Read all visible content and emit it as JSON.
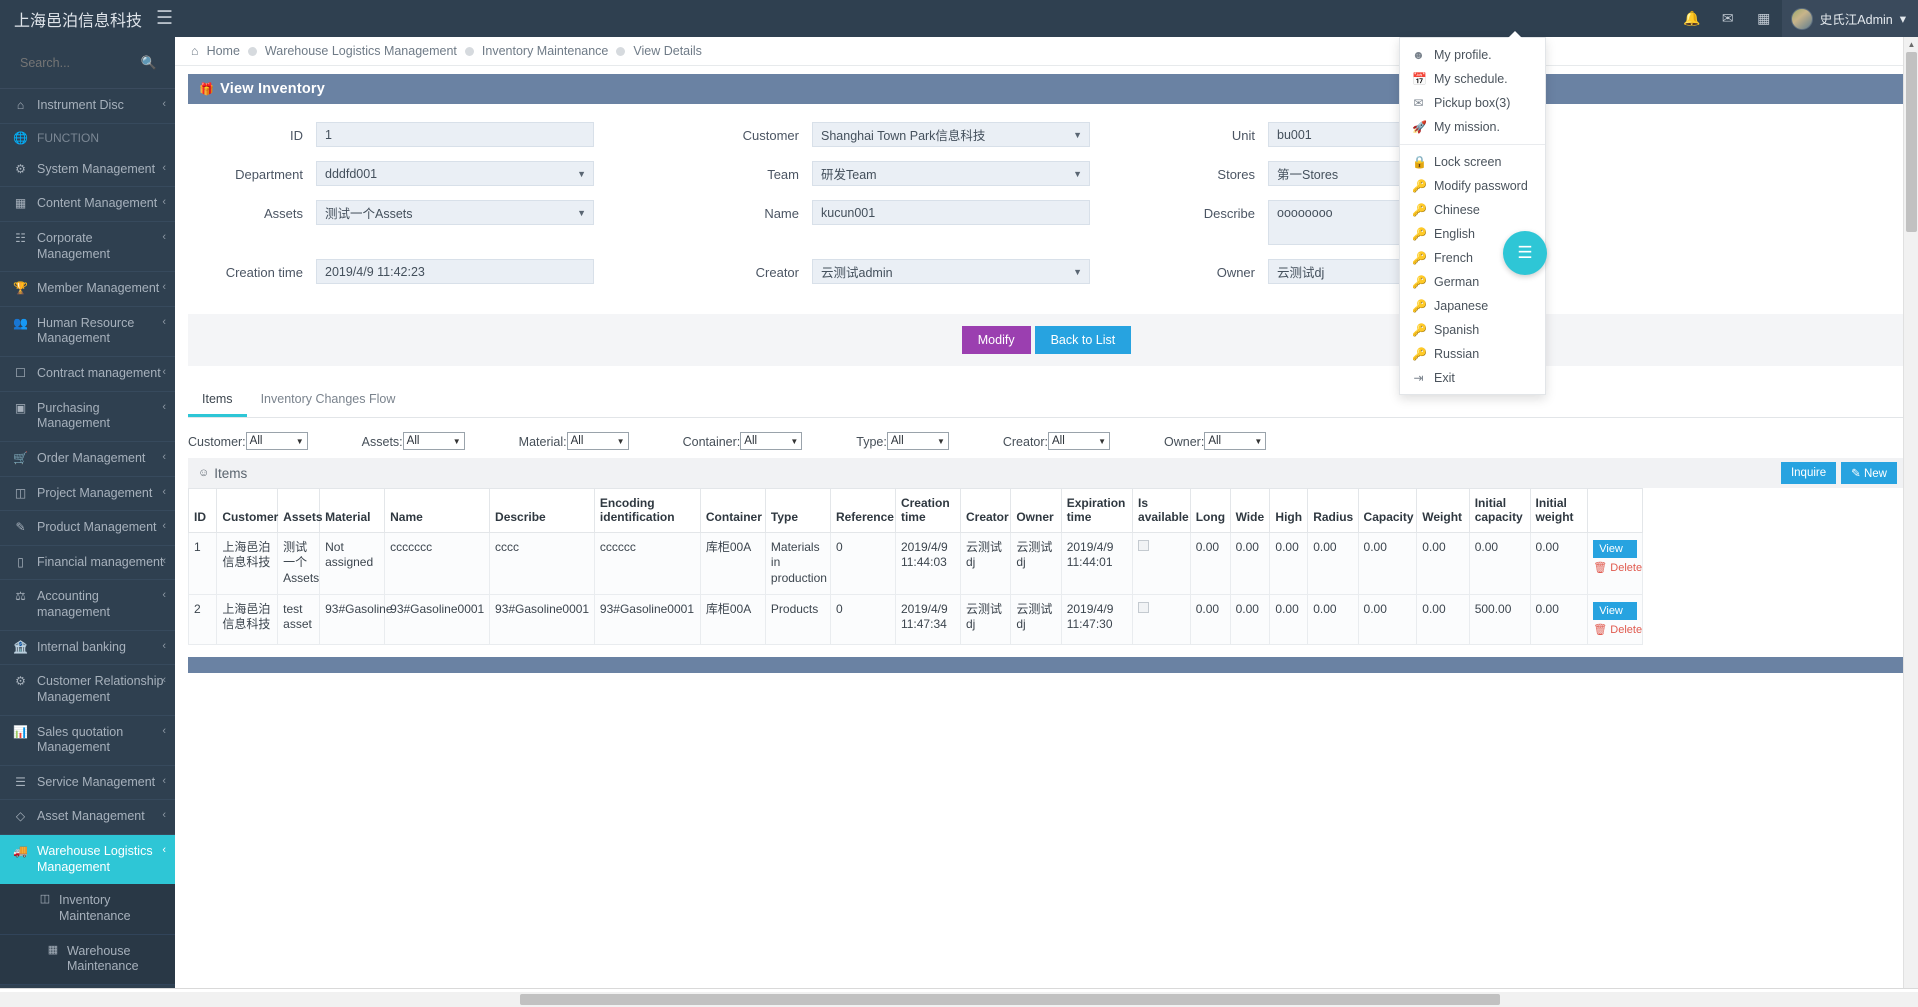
{
  "topbar": {
    "brand": "上海邑泊信息科技",
    "hamburger_icon": "hamburger-icon",
    "icons": [
      "bell-icon",
      "envelope-icon",
      "grid-icon"
    ],
    "user_name": "史氏江Admin",
    "user_caret": "▾"
  },
  "sidebar": {
    "search_placeholder": "Search...",
    "items": [
      {
        "label": "Instrument Disc",
        "icon": "home-icon",
        "caret": "‹",
        "type": "item"
      },
      {
        "label": "FUNCTION",
        "icon": "globe-icon",
        "caret": "",
        "type": "section"
      },
      {
        "label": "System Management",
        "icon": "gears-icon",
        "caret": "‹",
        "type": "item"
      },
      {
        "label": "Content Management",
        "icon": "article-icon",
        "caret": "‹",
        "type": "item"
      },
      {
        "label": "Corporate Management",
        "icon": "sitemap-icon",
        "caret": "‹",
        "type": "item"
      },
      {
        "label": "Member Management",
        "icon": "trophy-icon",
        "caret": "‹",
        "type": "item"
      },
      {
        "label": "Human Resource Management",
        "icon": "users-icon",
        "caret": "‹",
        "type": "item"
      },
      {
        "label": "Contract management",
        "icon": "document-icon",
        "caret": "‹",
        "type": "item"
      },
      {
        "label": "Purchasing Management",
        "icon": "box-icon",
        "caret": "‹",
        "type": "item"
      },
      {
        "label": "Order Management",
        "icon": "cart-icon",
        "caret": "‹",
        "type": "item"
      },
      {
        "label": "Project Management",
        "icon": "cubes-icon",
        "caret": "‹",
        "type": "item"
      },
      {
        "label": "Product Management",
        "icon": "edit-icon",
        "caret": "‹",
        "type": "item"
      },
      {
        "label": "Financial management",
        "icon": "money-icon",
        "caret": "‹",
        "type": "item"
      },
      {
        "label": "Accounting management",
        "icon": "balance-icon",
        "caret": "‹",
        "type": "item"
      },
      {
        "label": "Internal banking",
        "icon": "bank-icon",
        "caret": "‹",
        "type": "item"
      },
      {
        "label": "Customer Relationship Management",
        "icon": "gears-icon",
        "caret": "‹",
        "type": "item"
      },
      {
        "label": "Sales quotation Management",
        "icon": "chart-icon",
        "caret": "‹",
        "type": "item"
      },
      {
        "label": "Service Management",
        "icon": "list-icon",
        "caret": "‹",
        "type": "item"
      },
      {
        "label": "Asset Management",
        "icon": "diamond-icon",
        "caret": "‹",
        "type": "item"
      },
      {
        "label": "Warehouse Logistics Management",
        "icon": "truck-icon",
        "caret": "‹",
        "type": "active"
      }
    ],
    "subitems": [
      {
        "label": "Inventory Maintenance",
        "icon": "cubes-icon"
      },
      {
        "label": "Warehouse Maintenance",
        "icon": "warehouse-icon"
      }
    ]
  },
  "breadcrumb": {
    "home_icon": "home-icon",
    "items": [
      "Home",
      "Warehouse Logistics Management",
      "Inventory Maintenance",
      "View Details"
    ]
  },
  "panel": {
    "title": "View Inventory",
    "title_icon": "gift-icon"
  },
  "form": {
    "fields": [
      {
        "label": "ID",
        "value": "1",
        "type": "text"
      },
      {
        "label": "Customer",
        "value": "Shanghai Town Park信息科技",
        "type": "select"
      },
      {
        "label": "Unit",
        "value": "bu001",
        "type": "text"
      },
      {
        "label": "Department",
        "value": "dddfd001",
        "type": "select"
      },
      {
        "label": "Team",
        "value": "研发Team",
        "type": "select"
      },
      {
        "label": "Stores",
        "value": "第一Stores",
        "type": "text"
      },
      {
        "label": "Assets",
        "value": "测试一个Assets",
        "type": "select"
      },
      {
        "label": "Name",
        "value": "kucun001",
        "type": "text"
      },
      {
        "label": "Describe",
        "value": "oooooooo",
        "type": "textarea"
      },
      {
        "label": "Creation time",
        "value": "2019/4/9 11:42:23",
        "type": "text"
      },
      {
        "label": "Creator",
        "value": "云测试admin",
        "type": "select"
      },
      {
        "label": "Owner",
        "value": "云测试dj",
        "type": "text"
      }
    ],
    "buttons": {
      "modify": "Modify",
      "back": "Back to List"
    }
  },
  "tabs": [
    {
      "label": "Items",
      "active": true
    },
    {
      "label": "Inventory Changes Flow",
      "active": false
    }
  ],
  "filters": [
    {
      "label": "Customer:",
      "value": "All"
    },
    {
      "label": "Assets:",
      "value": "All"
    },
    {
      "label": "Material:",
      "value": "All"
    },
    {
      "label": "Container:",
      "value": "All"
    },
    {
      "label": "Type:",
      "value": "All"
    },
    {
      "label": "Creator:",
      "value": "All"
    },
    {
      "label": "Owner:",
      "value": "All"
    }
  ],
  "items_panel": {
    "title": "Items",
    "title_icon": "person-icon",
    "inquire_label": "Inquire",
    "new_label": "New",
    "new_icon": "pencil-icon"
  },
  "table": {
    "columns": [
      "ID",
      "Customer",
      "Assets",
      "Material",
      "Name",
      "Describe",
      "Encoding identification",
      "Container",
      "Type",
      "Reference",
      "Creation time",
      "Creator",
      "Owner",
      "Expiration time",
      "Is available",
      "Long",
      "Wide",
      "High",
      "Radius",
      "Capacity",
      "Weight",
      "Initial capacity",
      "Initial weight",
      ""
    ],
    "rows": [
      {
        "id": "1",
        "customer": "上海邑泊信息科技",
        "assets": "测试一个Assets",
        "material": "Not assigned",
        "name": "ccccccc",
        "describe": "cccc",
        "encoding": "cccccc",
        "container": "库柜00A",
        "type": "Materials in production",
        "reference": "0",
        "creation_time": "2019/4/9 11:44:03",
        "creator": "云测试dj",
        "owner": "云测试dj",
        "expiration_time": "2019/4/9 11:44:01",
        "is_available": "",
        "long": "0.00",
        "wide": "0.00",
        "high": "0.00",
        "radius": "0.00",
        "capacity": "0.00",
        "weight": "0.00",
        "initial_capacity": "0.00",
        "initial_weight": "0.00",
        "view_label": "View",
        "delete_label": "Delete"
      },
      {
        "id": "2",
        "customer": "上海邑泊信息科技",
        "assets": "test asset",
        "material": "93#Gasoline",
        "name": "93#Gasoline0001",
        "describe": "93#Gasoline0001",
        "encoding": "93#Gasoline0001",
        "container": "库柜00A",
        "type": "Products",
        "reference": "0",
        "creation_time": "2019/4/9 11:47:34",
        "creator": "云测试dj",
        "owner": "云测试dj",
        "expiration_time": "2019/4/9 11:47:30",
        "is_available": "",
        "long": "0.00",
        "wide": "0.00",
        "high": "0.00",
        "radius": "0.00",
        "capacity": "0.00",
        "weight": "0.00",
        "initial_capacity": "500.00",
        "initial_weight": "0.00",
        "view_label": "View",
        "delete_label": "Delete"
      }
    ]
  },
  "usermenu": {
    "groups": [
      [
        {
          "label": "My profile.",
          "icon": "user-icon"
        },
        {
          "label": "My schedule.",
          "icon": "calendar-icon"
        },
        {
          "label": "Pickup box(3)",
          "icon": "envelope-icon"
        },
        {
          "label": "My mission.",
          "icon": "rocket-icon"
        }
      ],
      [
        {
          "label": "Lock screen",
          "icon": "lock-icon"
        },
        {
          "label": "Modify password",
          "icon": "key-icon"
        },
        {
          "label": "Chinese",
          "icon": "key-icon"
        },
        {
          "label": "English",
          "icon": "key-icon"
        },
        {
          "label": "French",
          "icon": "key-icon"
        },
        {
          "label": "German",
          "icon": "key-icon"
        },
        {
          "label": "Japanese",
          "icon": "key-icon"
        },
        {
          "label": "Spanish",
          "icon": "key-icon"
        },
        {
          "label": "Russian",
          "icon": "key-icon"
        },
        {
          "label": "Exit",
          "icon": "exit-icon"
        }
      ]
    ]
  },
  "fab": {
    "icon": "menu-icon"
  },
  "statusbar": {
    "text": "javascript:;"
  },
  "colors": {
    "sidebar_bg": "#2f4050",
    "accent_cyan": "#2ec6d6",
    "panel_header": "#6a82a3",
    "primary_blue": "#27a3e0",
    "modify_purple": "#9b3fb0",
    "danger_red": "#e05a4f"
  }
}
